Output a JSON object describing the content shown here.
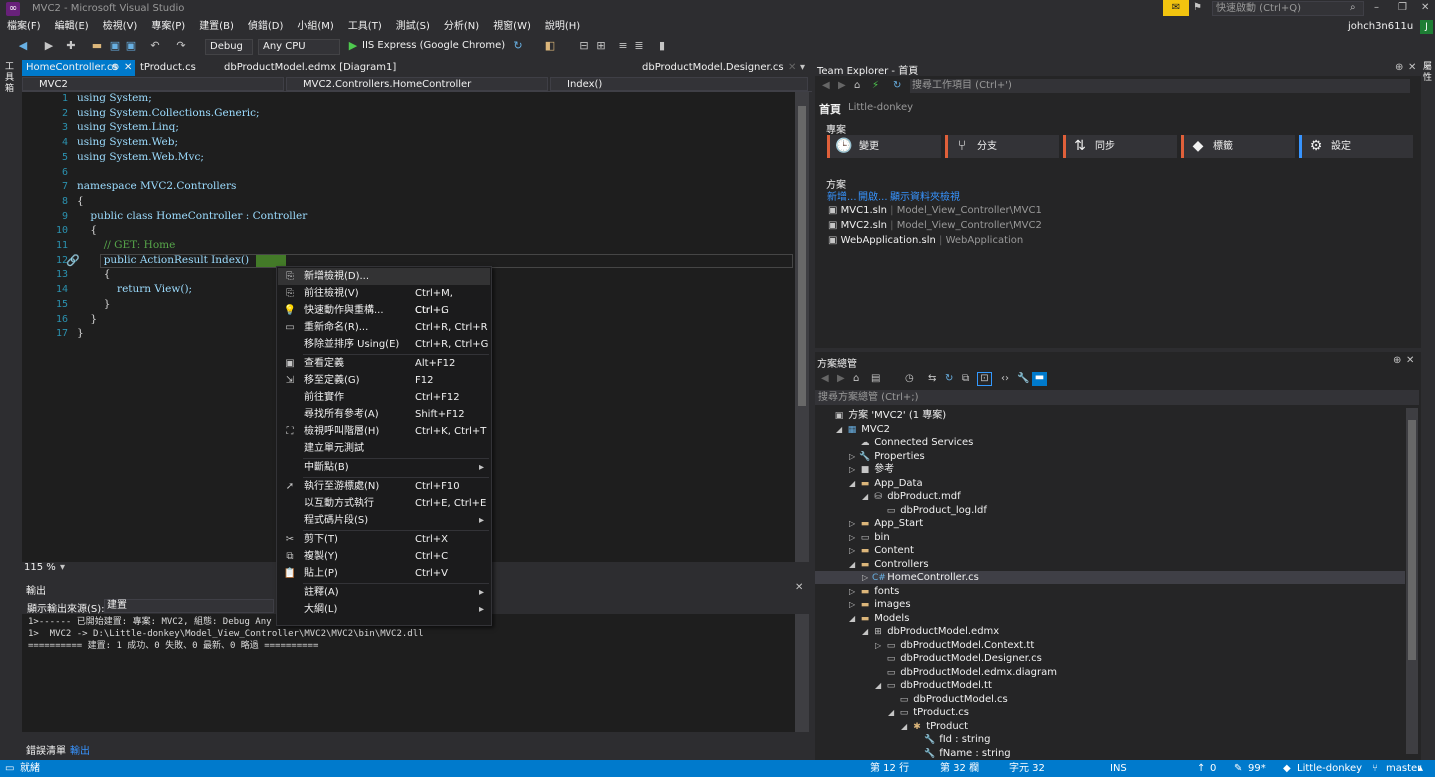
{
  "app": {
    "title": "MVC2 - Microsoft Visual Studio",
    "quick_launch": "快速啟動 (Ctrl+Q)",
    "user": "johch3n611u",
    "user_initial": "J"
  },
  "menu": [
    "檔案(F)",
    "編輯(E)",
    "檢視(V)",
    "專案(P)",
    "建置(B)",
    "偵錯(D)",
    "小組(M)",
    "工具(T)",
    "測試(S)",
    "分析(N)",
    "視窗(W)",
    "說明(H)"
  ],
  "toolbar": {
    "config": "Debug",
    "platform": "Any CPU",
    "run_target": "IIS Express (Google Chrome)"
  },
  "left_strip_label": "工具箱",
  "right_strip_label": "屬性",
  "doc_tabs": [
    {
      "label": "HomeController.cs",
      "pin": "⊕",
      "close": "✕"
    },
    {
      "label": "tProduct.cs"
    },
    {
      "label": "dbProductModel.edmx [Diagram1]"
    },
    {
      "label": "dbProductModel.Designer.cs"
    }
  ],
  "navbar": {
    "project": "MVC2",
    "class": "MVC2.Controllers.HomeController",
    "member": "Index()"
  },
  "code_lines": [
    {
      "n": "1",
      "text": "using System;"
    },
    {
      "n": "2",
      "text": "using System.Collections.Generic;"
    },
    {
      "n": "3",
      "text": "using System.Linq;"
    },
    {
      "n": "4",
      "text": "using System.Web;"
    },
    {
      "n": "5",
      "text": "using System.Web.Mvc;"
    },
    {
      "n": "6",
      "text": ""
    },
    {
      "n": "7",
      "text": "namespace MVC2.Controllers"
    },
    {
      "n": "8",
      "text": "{"
    },
    {
      "n": "9",
      "text": "    public class HomeController : Controller"
    },
    {
      "n": "10",
      "text": "    {"
    },
    {
      "n": "11",
      "text": "        // GET: Home"
    },
    {
      "n": "12",
      "text": "        public ActionResult Index()"
    },
    {
      "n": "13",
      "text": "        {"
    },
    {
      "n": "14",
      "text": "            return View();"
    },
    {
      "n": "15",
      "text": "        }"
    },
    {
      "n": "16",
      "text": "    }"
    },
    {
      "n": "17",
      "text": "}"
    }
  ],
  "zoom": "115 %",
  "output": {
    "title": "輸出",
    "source_label": "顯示輸出來源(S):",
    "source_value": "建置",
    "lines": [
      "1>------ 已開始建置: 專案: MVC2, 組態: Debug Any CPU ------",
      "1>  MVC2 -> D:\\Little-donkey\\Model_View_Controller\\MVC2\\MVC2\\bin\\MVC2.dll",
      "========== 建置: 1 成功、0 失敗、0 最新、0 略過 =========="
    ],
    "tabs": [
      "錯誤清單",
      "輸出"
    ]
  },
  "context_menu": [
    {
      "label": "新增檢視(D)...",
      "shortcut": "",
      "icon": "add-view-icon",
      "glyph": "⎘"
    },
    {
      "label": "前往檢視(V)",
      "shortcut": "Ctrl+M, Ctrl+G",
      "icon": "go-to-view-icon",
      "glyph": "⎘"
    },
    {
      "label": "快速動作與重構...",
      "shortcut": "Ctrl+.",
      "icon": "lightbulb-icon",
      "glyph": "💡"
    },
    {
      "label": "重新命名(R)...",
      "shortcut": "Ctrl+R, Ctrl+R",
      "icon": "rename-icon",
      "glyph": "▭"
    },
    {
      "label": "移除並排序 Using(E)",
      "shortcut": "Ctrl+R, Ctrl+G",
      "icon": "",
      "glyph": ""
    },
    {
      "label": "查看定義",
      "shortcut": "Alt+F12",
      "icon": "peek-definition-icon",
      "glyph": "▣"
    },
    {
      "label": "移至定義(G)",
      "shortcut": "F12",
      "icon": "go-to-definition-icon",
      "glyph": "⇲"
    },
    {
      "label": "前往實作",
      "shortcut": "Ctrl+F12",
      "icon": "",
      "glyph": ""
    },
    {
      "label": "尋找所有參考(A)",
      "shortcut": "Shift+F12",
      "icon": "",
      "glyph": ""
    },
    {
      "label": "檢視呼叫階層(H)",
      "shortcut": "Ctrl+K, Ctrl+T",
      "icon": "call-hierarchy-icon",
      "glyph": "⛶"
    },
    {
      "label": "建立單元測試",
      "shortcut": "",
      "icon": "",
      "glyph": ""
    },
    {
      "label": "中斷點(B)",
      "shortcut": "",
      "icon": "",
      "glyph": "",
      "submenu": true
    },
    {
      "label": "執行至游標處(N)",
      "shortcut": "Ctrl+F10",
      "icon": "run-to-cursor-icon",
      "glyph": "➚"
    },
    {
      "label": "以互動方式執行",
      "shortcut": "Ctrl+E, Ctrl+E",
      "icon": "",
      "glyph": ""
    },
    {
      "label": "程式碼片段(S)",
      "shortcut": "",
      "icon": "",
      "glyph": "",
      "submenu": true
    },
    {
      "label": "剪下(T)",
      "shortcut": "Ctrl+X",
      "icon": "cut-icon",
      "glyph": "✂"
    },
    {
      "label": "複製(Y)",
      "shortcut": "Ctrl+C",
      "icon": "copy-icon",
      "glyph": "⧉"
    },
    {
      "label": "貼上(P)",
      "shortcut": "Ctrl+V",
      "icon": "paste-icon",
      "glyph": "📋"
    },
    {
      "label": "註釋(A)",
      "shortcut": "",
      "icon": "",
      "glyph": "",
      "submenu": true
    },
    {
      "label": "大綱(L)",
      "shortcut": "",
      "icon": "",
      "glyph": "",
      "submenu": true
    }
  ],
  "team_explorer": {
    "title": "Team Explorer - 首頁",
    "search_placeholder": "搜尋工作項目 (Ctrl+')",
    "home_label": "首頁",
    "home_project": "Little-donkey",
    "project_section": "專案",
    "buttons": [
      {
        "label": "變更",
        "icon": "clock-icon",
        "glyph": "🕒",
        "color": "#e0603a"
      },
      {
        "label": "分支",
        "icon": "branch-icon",
        "glyph": "⑂",
        "color": "#e0603a"
      },
      {
        "label": "同步",
        "icon": "sync-icon",
        "glyph": "⇅",
        "color": "#e0603a"
      },
      {
        "label": "標籤",
        "icon": "tag-icon",
        "glyph": "◆",
        "color": "#e0603a"
      },
      {
        "label": "設定",
        "icon": "gear-icon",
        "glyph": "⚙",
        "color": "#3794ff"
      }
    ],
    "solutions_section": "方案",
    "links": [
      "新增...",
      "開啟...",
      "顯示資料夾檢視"
    ],
    "solutions": [
      {
        "name": "MVC1.sln",
        "path": "Model_View_Controller\\MVC1"
      },
      {
        "name": "MVC2.sln",
        "path": "Model_View_Controller\\MVC2"
      },
      {
        "name": "WebApplication.sln",
        "path": "WebApplication"
      }
    ]
  },
  "solution_explorer": {
    "title": "方案總管",
    "search_placeholder": "搜尋方案總管 (Ctrl+;)",
    "nodes": [
      {
        "label": "方案 'MVC2' (1 專案)",
        "indent": 0,
        "exp": "",
        "glyph": "▣",
        "color": "#c5c5c5"
      },
      {
        "label": "MVC2",
        "indent": 1,
        "exp": "◢",
        "glyph": "▦",
        "color": "#68b0e3"
      },
      {
        "label": "Connected Services",
        "indent": 2,
        "exp": "",
        "glyph": "☁",
        "color": "#c5c5c5"
      },
      {
        "label": "Properties",
        "indent": 2,
        "exp": "▷",
        "glyph": "🔧",
        "color": "#c5c5c5"
      },
      {
        "label": "參考",
        "indent": 2,
        "exp": "▷",
        "glyph": "■",
        "color": "#c5c5c5"
      },
      {
        "label": "App_Data",
        "indent": 2,
        "exp": "◢",
        "glyph": "▬",
        "color": "#dcb67a"
      },
      {
        "label": "dbProduct.mdf",
        "indent": 3,
        "exp": "◢",
        "glyph": "⛁",
        "color": "#c5c5c5"
      },
      {
        "label": "dbProduct_log.ldf",
        "indent": 4,
        "exp": "",
        "glyph": "▭",
        "color": "#c5c5c5"
      },
      {
        "label": "App_Start",
        "indent": 2,
        "exp": "▷",
        "glyph": "▬",
        "color": "#dcb67a"
      },
      {
        "label": "bin",
        "indent": 2,
        "exp": "▷",
        "glyph": "▭",
        "color": "#c5c5c5"
      },
      {
        "label": "Content",
        "indent": 2,
        "exp": "▷",
        "glyph": "▬",
        "color": "#dcb67a"
      },
      {
        "label": "Controllers",
        "indent": 2,
        "exp": "◢",
        "glyph": "▬",
        "color": "#dcb67a"
      },
      {
        "label": "HomeController.cs",
        "indent": 3,
        "exp": "▷",
        "glyph": "C#",
        "color": "#68b0e3",
        "selected": true
      },
      {
        "label": "fonts",
        "indent": 2,
        "exp": "▷",
        "glyph": "▬",
        "color": "#dcb67a"
      },
      {
        "label": "images",
        "indent": 2,
        "exp": "▷",
        "glyph": "▬",
        "color": "#dcb67a"
      },
      {
        "label": "Models",
        "indent": 2,
        "exp": "◢",
        "glyph": "▬",
        "color": "#dcb67a"
      },
      {
        "label": "dbProductModel.edmx",
        "indent": 3,
        "exp": "◢",
        "glyph": "⊞",
        "color": "#c5c5c5"
      },
      {
        "label": "dbProductModel.Context.tt",
        "indent": 4,
        "exp": "▷",
        "glyph": "▭",
        "color": "#c5c5c5"
      },
      {
        "label": "dbProductModel.Designer.cs",
        "indent": 4,
        "exp": "",
        "glyph": "▭",
        "color": "#c5c5c5"
      },
      {
        "label": "dbProductModel.edmx.diagram",
        "indent": 4,
        "exp": "",
        "glyph": "▭",
        "color": "#c5c5c5"
      },
      {
        "label": "dbProductModel.tt",
        "indent": 4,
        "exp": "◢",
        "glyph": "▭",
        "color": "#c5c5c5"
      },
      {
        "label": "dbProductModel.cs",
        "indent": 5,
        "exp": "",
        "glyph": "▭",
        "color": "#c5c5c5"
      },
      {
        "label": "tProduct.cs",
        "indent": 5,
        "exp": "◢",
        "glyph": "▭",
        "color": "#c5c5c5"
      },
      {
        "label": "tProduct",
        "indent": 6,
        "exp": "◢",
        "glyph": "✱",
        "color": "#dcb67a"
      },
      {
        "label": "fId : string",
        "indent": 7,
        "exp": "",
        "glyph": "🔧",
        "color": "#c5c5c5"
      },
      {
        "label": "fName : string",
        "indent": 7,
        "exp": "",
        "glyph": "🔧",
        "color": "#c5c5c5"
      }
    ]
  },
  "status": {
    "ready": "就緒",
    "line": "第 12 行",
    "col": "第 32 欄",
    "char": "字元 32",
    "ins": "INS",
    "up": "0",
    "pending": "99*",
    "repo": "Little-donkey",
    "branch": "master"
  },
  "colors": {
    "accent": "#007acc",
    "bg": "#2d2d30",
    "editor": "#1e1e1e"
  }
}
